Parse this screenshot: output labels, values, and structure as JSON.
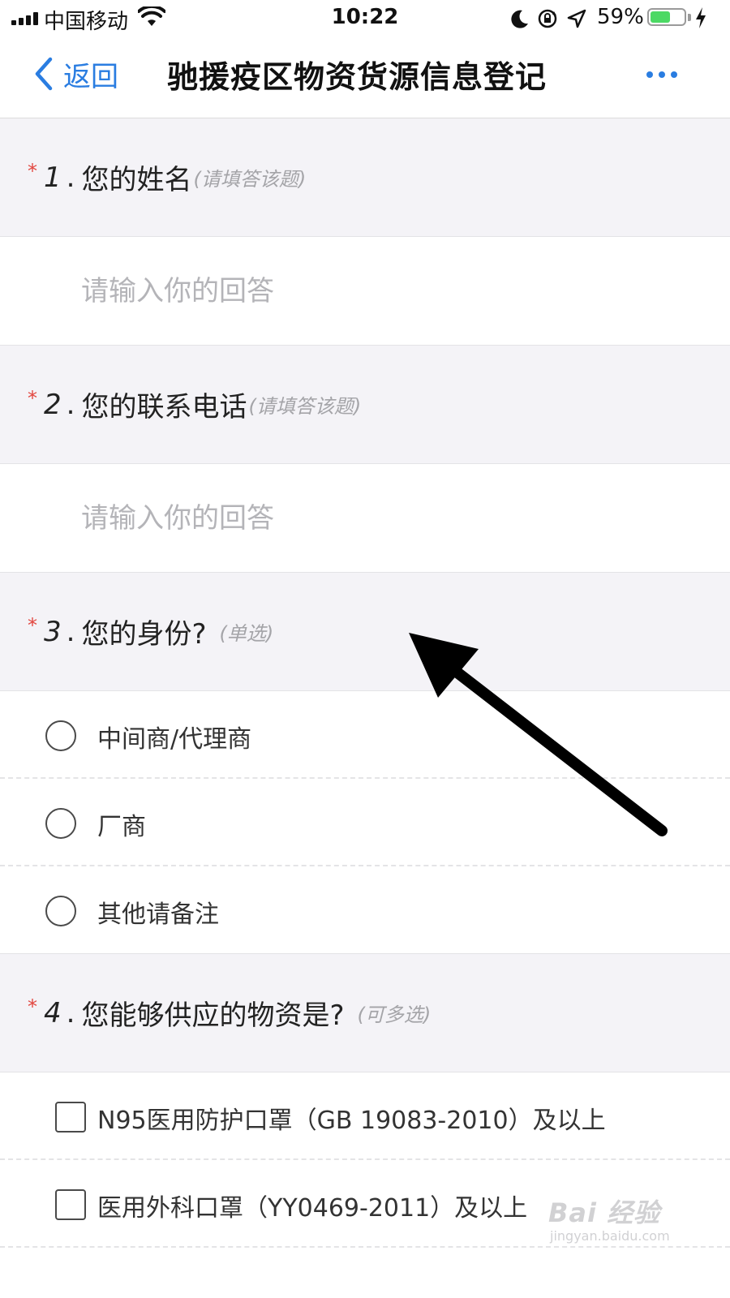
{
  "status_bar": {
    "carrier": "中国移动",
    "time": "10:22",
    "battery_percent": "59%",
    "battery_level": 0.59,
    "icons": [
      "signal-icon",
      "wifi-icon",
      "moon-icon",
      "orientation-lock-icon",
      "location-icon",
      "battery-icon",
      "charging-icon"
    ]
  },
  "nav": {
    "back_label": "返回",
    "title": "驰援疫区物资货源信息登记",
    "more_icon": "more-icon",
    "accent_color": "#2a7de1"
  },
  "questions": [
    {
      "required_mark": "*",
      "number": "1",
      "dot": ".",
      "text": "您的姓名",
      "hint": "(请填答该题)",
      "answer_placeholder": "请输入你的回答",
      "answer_value": ""
    },
    {
      "required_mark": "*",
      "number": "2",
      "dot": ".",
      "text": "您的联系电话",
      "hint": "(请填答该题)",
      "answer_placeholder": "请输入你的回答",
      "answer_value": ""
    },
    {
      "required_mark": "*",
      "number": "3",
      "dot": ".",
      "text": "您的身份?",
      "hint": "(单选)",
      "options": [
        "中间商/代理商",
        "厂商",
        "其他请备注"
      ]
    },
    {
      "required_mark": "*",
      "number": "4",
      "dot": ".",
      "text": "您能够供应的物资是?",
      "hint": "(可多选)",
      "options": [
        "N95医用防护口罩（GB 19083-2010）及以上",
        "医用外科口罩（YY0469-2011）及以上"
      ]
    }
  ],
  "watermark": {
    "brand": "Bai 经验",
    "site": "jingyan.baidu.com"
  }
}
